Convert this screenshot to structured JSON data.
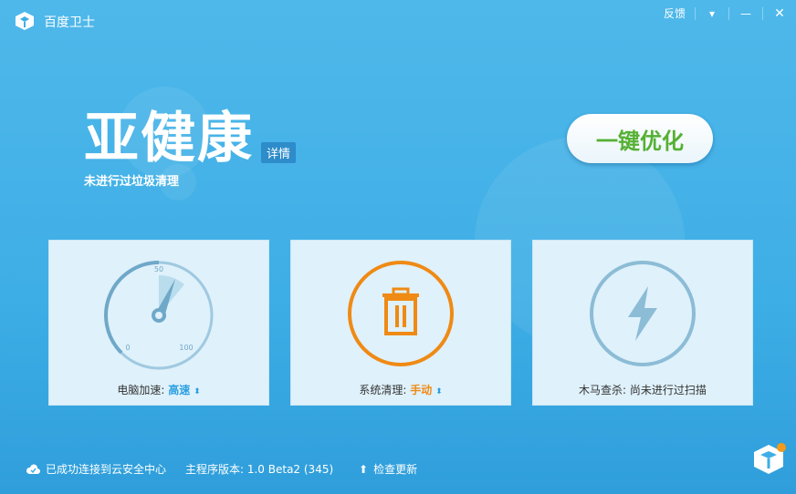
{
  "app": {
    "title": "百度卫士"
  },
  "window": {
    "feedback": "反馈",
    "menu_glyph": "▾",
    "minimize_glyph": "—",
    "close_glyph": "✕"
  },
  "status": {
    "title": "亚健康",
    "detail": "详情",
    "subtitle": "未进行过垃圾清理"
  },
  "optimize": {
    "label": "一键优化"
  },
  "cards": {
    "speed": {
      "label": "电脑加速:",
      "value": "高速",
      "gauge": {
        "min": "0",
        "mid": "50",
        "max": "100"
      }
    },
    "clean": {
      "label": "系统清理:",
      "value": "手动"
    },
    "trojan": {
      "label": "木马查杀:",
      "value": "尚未进行过扫描"
    }
  },
  "footer": {
    "cloud": "已成功连接到云安全中心",
    "version": "主程序版本: 1.0 Beta2 (345)",
    "update": "检查更新"
  },
  "colors": {
    "accent": "#2a9fe0",
    "green": "#55b033",
    "orange": "#ef8a14",
    "bg": "#3eaee6"
  }
}
